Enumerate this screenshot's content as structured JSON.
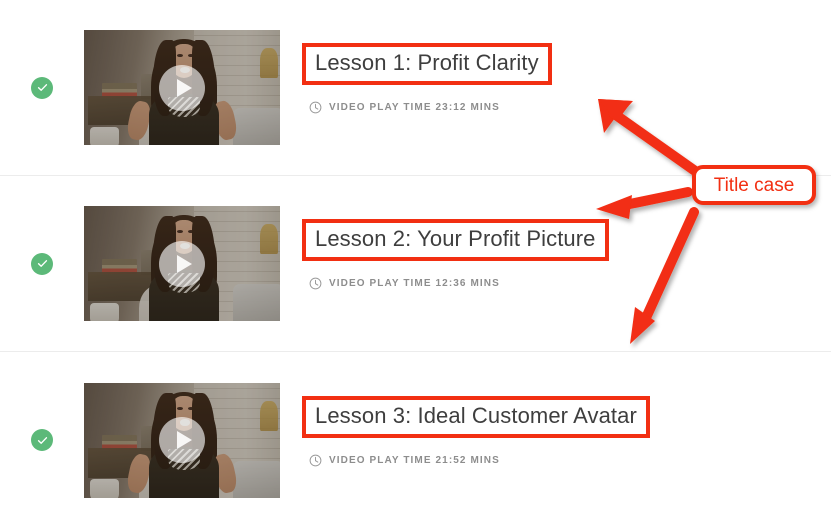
{
  "page": {
    "background_color": "#ffffff",
    "annotation_color": "#f22f12",
    "complete_badge_color": "#5cb979",
    "title_color": "#3e3e3e",
    "meta_color": "#8d8d8d",
    "divider_color": "#ececec"
  },
  "lessons": [
    {
      "status_icon": "check-icon",
      "status": "completed",
      "thumbnail_icon": "play-icon",
      "title": "Lesson 1: Profit Clarity",
      "meta_icon": "clock-icon",
      "meta": "VIDEO PLAY TIME 23:12 MINS",
      "duration": "23:12"
    },
    {
      "status_icon": "check-icon",
      "status": "completed",
      "thumbnail_icon": "play-icon",
      "title": "Lesson 2: Your Profit Picture",
      "meta_icon": "clock-icon",
      "meta": "VIDEO PLAY TIME 12:36 MINS",
      "duration": "12:36"
    },
    {
      "status_icon": "check-icon",
      "status": "completed",
      "thumbnail_icon": "play-icon",
      "title": "Lesson 3: Ideal Customer Avatar",
      "meta_icon": "clock-icon",
      "meta": "VIDEO PLAY TIME 21:52 MINS",
      "duration": "21:52"
    }
  ],
  "annotation": {
    "callout_label": "Title case",
    "arrow_count": 3,
    "arrow_targets": [
      "Lesson 1: Profit Clarity",
      "Lesson 2: Your Profit Picture",
      "Lesson 3: Ideal Customer Avatar"
    ]
  }
}
